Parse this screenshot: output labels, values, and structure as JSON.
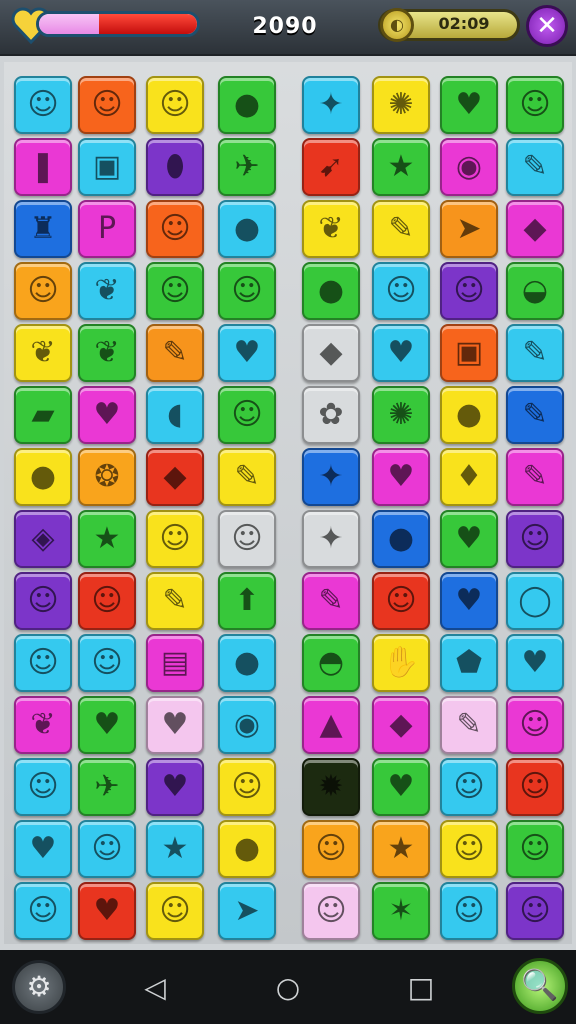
{
  "hud": {
    "health_fraction": 0.38,
    "score": "2090",
    "timer": "02:09",
    "close_glyph": "✕",
    "coin_glyph": "◐"
  },
  "board": {
    "tiles": [
      {
        "c": "#35c9ef",
        "i": "☺"
      },
      {
        "c": "#f7641c",
        "i": "☺"
      },
      {
        "c": "#f9e21c",
        "i": "☺"
      },
      {
        "c": "#37c83a",
        "i": "●"
      },
      {
        "c": "#30c6ef",
        "i": "✦"
      },
      {
        "c": "#f9e21c",
        "i": "✺"
      },
      {
        "c": "#37c83a",
        "i": "♥"
      },
      {
        "c": "#37c83a",
        "i": "☺"
      },
      {
        "c": "#ea38d4",
        "i": "❚"
      },
      {
        "c": "#35c9ef",
        "i": "▣"
      },
      {
        "c": "#7c35c9",
        "i": "⬮"
      },
      {
        "c": "#37c83a",
        "i": "✈"
      },
      {
        "c": "#e8351f",
        "i": "➹"
      },
      {
        "c": "#37c83a",
        "i": "★"
      },
      {
        "c": "#ea38d4",
        "i": "◉"
      },
      {
        "c": "#35c9ef",
        "i": "✎"
      },
      {
        "c": "#1e6fe0",
        "i": "♜"
      },
      {
        "c": "#ea38d4",
        "i": "P"
      },
      {
        "c": "#f7641c",
        "i": "☺"
      },
      {
        "c": "#35c9ef",
        "i": "●"
      },
      {
        "c": "#f9e21c",
        "i": "❦"
      },
      {
        "c": "#f9e21c",
        "i": "✎"
      },
      {
        "c": "#f7941c",
        "i": "➤"
      },
      {
        "c": "#ea38d4",
        "i": "◆"
      },
      {
        "c": "#f9a41c",
        "i": "☺"
      },
      {
        "c": "#35c9ef",
        "i": "❦"
      },
      {
        "c": "#37c83a",
        "i": "☺"
      },
      {
        "c": "#37c83a",
        "i": "☺"
      },
      {
        "c": "#37c83a",
        "i": "●"
      },
      {
        "c": "#35c9ef",
        "i": "☺"
      },
      {
        "c": "#7c35c9",
        "i": "☺"
      },
      {
        "c": "#37c83a",
        "i": "◒"
      },
      {
        "c": "#f9e21c",
        "i": "❦"
      },
      {
        "c": "#37c83a",
        "i": "❦"
      },
      {
        "c": "#f7941c",
        "i": "✎"
      },
      {
        "c": "#35c9ef",
        "i": "♥"
      },
      {
        "c": "#d8dbdd",
        "i": "◆"
      },
      {
        "c": "#35c9ef",
        "i": "♥"
      },
      {
        "c": "#f7641c",
        "i": "▣"
      },
      {
        "c": "#35c9ef",
        "i": "✎"
      },
      {
        "c": "#37c83a",
        "i": "▰"
      },
      {
        "c": "#ea38d4",
        "i": "♥"
      },
      {
        "c": "#35c9ef",
        "i": "◖"
      },
      {
        "c": "#37c83a",
        "i": "☺"
      },
      {
        "c": "#d8dbdd",
        "i": "✿"
      },
      {
        "c": "#37c83a",
        "i": "✺"
      },
      {
        "c": "#f9e21c",
        "i": "●"
      },
      {
        "c": "#1e6fe0",
        "i": "✎"
      },
      {
        "c": "#f9e21c",
        "i": "●"
      },
      {
        "c": "#f9a41c",
        "i": "❂"
      },
      {
        "c": "#e8351f",
        "i": "◆"
      },
      {
        "c": "#f9e21c",
        "i": "✎"
      },
      {
        "c": "#1e6fe0",
        "i": "✦"
      },
      {
        "c": "#ea38d4",
        "i": "♥"
      },
      {
        "c": "#f9e21c",
        "i": "♦"
      },
      {
        "c": "#ea38d4",
        "i": "✎"
      },
      {
        "c": "#7c35c9",
        "i": "◈"
      },
      {
        "c": "#37c83a",
        "i": "★"
      },
      {
        "c": "#f9e21c",
        "i": "☺"
      },
      {
        "c": "#d8dbdd",
        "i": "☺"
      },
      {
        "c": "#d8dbdd",
        "i": "✦"
      },
      {
        "c": "#1e6fe0",
        "i": "●"
      },
      {
        "c": "#37c83a",
        "i": "♥"
      },
      {
        "c": "#7c35c9",
        "i": "☺"
      },
      {
        "c": "#7c35c9",
        "i": "☺"
      },
      {
        "c": "#e8351f",
        "i": "☺"
      },
      {
        "c": "#f9e21c",
        "i": "✎"
      },
      {
        "c": "#37c83a",
        "i": "⬆"
      },
      {
        "c": "#ea38d4",
        "i": "✎"
      },
      {
        "c": "#e8351f",
        "i": "☺"
      },
      {
        "c": "#1e6fe0",
        "i": "♥"
      },
      {
        "c": "#35c9ef",
        "i": "◯"
      },
      {
        "c": "#35c9ef",
        "i": "☺"
      },
      {
        "c": "#35c9ef",
        "i": "☺"
      },
      {
        "c": "#ea38d4",
        "i": "▤"
      },
      {
        "c": "#35c9ef",
        "i": "●"
      },
      {
        "c": "#37c83a",
        "i": "◓"
      },
      {
        "c": "#f9e21c",
        "i": "✋"
      },
      {
        "c": "#35c9ef",
        "i": "⬟"
      },
      {
        "c": "#35c9ef",
        "i": "♥"
      },
      {
        "c": "#ea38d4",
        "i": "❦"
      },
      {
        "c": "#37c83a",
        "i": "♥"
      },
      {
        "c": "#f4c6ee",
        "i": "♥"
      },
      {
        "c": "#35c9ef",
        "i": "◉"
      },
      {
        "c": "#ea38d4",
        "i": "▲"
      },
      {
        "c": "#ea38d4",
        "i": "◆"
      },
      {
        "c": "#f4c6ee",
        "i": "✎"
      },
      {
        "c": "#ea38d4",
        "i": "☺"
      },
      {
        "c": "#35c9ef",
        "i": "☺"
      },
      {
        "c": "#37c83a",
        "i": "✈"
      },
      {
        "c": "#7c35c9",
        "i": "♥"
      },
      {
        "c": "#f9e21c",
        "i": "☺"
      },
      {
        "c": "#1c2a10",
        "i": "✹"
      },
      {
        "c": "#37c83a",
        "i": "♥"
      },
      {
        "c": "#35c9ef",
        "i": "☺"
      },
      {
        "c": "#e8351f",
        "i": "☺"
      },
      {
        "c": "#35c9ef",
        "i": "♥"
      },
      {
        "c": "#35c9ef",
        "i": "☺"
      },
      {
        "c": "#35c9ef",
        "i": "★"
      },
      {
        "c": "#f9e21c",
        "i": "●"
      },
      {
        "c": "#f9a41c",
        "i": "☺"
      },
      {
        "c": "#f9a41c",
        "i": "★"
      },
      {
        "c": "#f9e21c",
        "i": "☺"
      },
      {
        "c": "#37c83a",
        "i": "☺"
      },
      {
        "c": "#35c9ef",
        "i": "☺"
      },
      {
        "c": "#e8351f",
        "i": "♥"
      },
      {
        "c": "#f9e21c",
        "i": "☺"
      },
      {
        "c": "#35c9ef",
        "i": "➤"
      },
      {
        "c": "#f4c6ee",
        "i": "☺"
      },
      {
        "c": "#37c83a",
        "i": "✶"
      },
      {
        "c": "#35c9ef",
        "i": "☺"
      },
      {
        "c": "#7c35c9",
        "i": "☺"
      }
    ]
  },
  "navbar": {
    "gear_glyph": "⚙",
    "back_glyph": "◁",
    "home_glyph": "○",
    "recents_glyph": "□",
    "search_glyph": "🔍"
  }
}
